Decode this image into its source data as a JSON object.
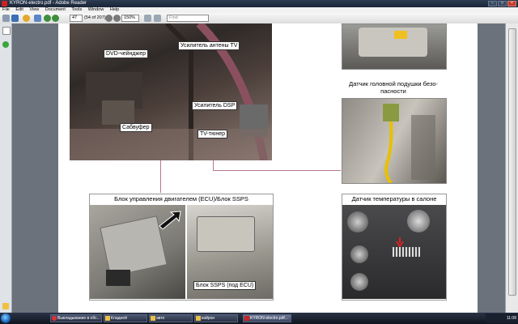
{
  "window": {
    "title": "KYRON-electro.pdf - Adobe Reader",
    "minimize": "–",
    "maximize": "□",
    "close": "×"
  },
  "menu": [
    "File",
    "Edit",
    "View",
    "Document",
    "Tools",
    "Window",
    "Help"
  ],
  "toolbar": {
    "page_number": "47",
    "page_count": "(54 of 207)",
    "zoom": "150%",
    "find_placeholder": "Find"
  },
  "page": {
    "main_labels": {
      "dvd": "DVD-чейнджер",
      "tv_amp": "Усилитель антены TV",
      "dsp": "Усилитель DSP",
      "subwoofer": "Сабвуфер",
      "tv_tuner": "TV-тюнер"
    },
    "headrest_caption": "Датчик головной подушки безо-\nпасности",
    "ecu_caption": "Блок управления двигателем (ECU)/Блок SSPS",
    "ssps_label": "Блок SSPS (под ECU)",
    "temp_caption": "Датчик температуры в салоне"
  },
  "taskbar": [
    {
      "label": "Выкладывание в обс..."
    },
    {
      "label": "Кладней"
    },
    {
      "label": "авто"
    },
    {
      "label": "кайрон"
    },
    {
      "label": "KYRON-electro.pdf..."
    }
  ],
  "clock": "11:08",
  "colors": {
    "accent": "#1a62b8",
    "leader_line": "#b77a8a"
  }
}
